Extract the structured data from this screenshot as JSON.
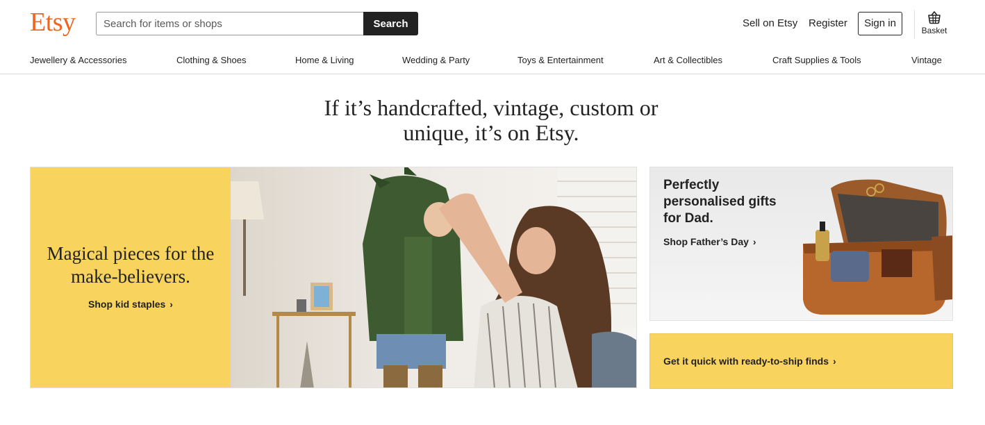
{
  "header": {
    "logo": "Etsy",
    "search": {
      "placeholder": "Search for items or shops",
      "value": "",
      "button_label": "Search"
    },
    "sell_label": "Sell on Etsy",
    "register_label": "Register",
    "signin_label": "Sign in",
    "basket_label": "Basket"
  },
  "categories": [
    "Jewellery & Accessories",
    "Clothing & Shoes",
    "Home & Living",
    "Wedding & Party",
    "Toys & Entertainment",
    "Art & Collectibles",
    "Craft Supplies & Tools",
    "Vintage"
  ],
  "headline": {
    "line1": "If it’s handcrafted, vintage, custom or",
    "line2": "unique, it’s on Etsy."
  },
  "hero": {
    "title_line1": "Magical pieces for the",
    "title_line2": "make-believers.",
    "link_label": "Shop kid staples",
    "image": "woman-fitting-dinosaur-hoodie-on-child-photo"
  },
  "fathers_day_card": {
    "title_line1": "Perfectly",
    "title_line2": "personalised gifts",
    "title_line3": "for Dad.",
    "link_label": "Shop Father’s Day",
    "image": "leather-toiletry-bag-photo"
  },
  "ready_card": {
    "link_label": "Get it quick with ready-to-ship finds"
  },
  "colors": {
    "brand": "#F1641E",
    "yellow": "#F8D45F",
    "text": "#222222",
    "button_dark": "#222222"
  },
  "icons": {
    "chevron": "chevron-right-icon",
    "basket": "basket-icon"
  }
}
